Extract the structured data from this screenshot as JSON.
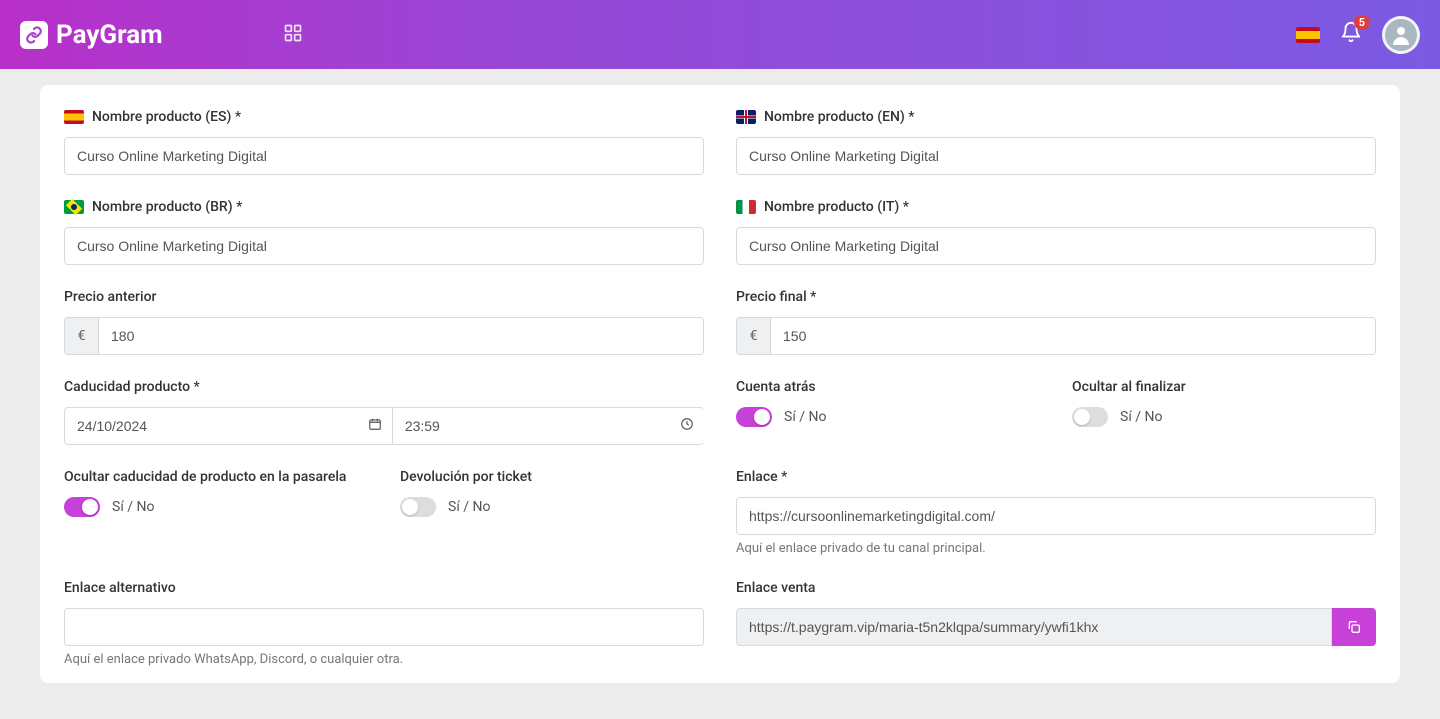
{
  "brand": {
    "name": "PayGram"
  },
  "topbar": {
    "notifications": "5"
  },
  "form": {
    "name_es_label": "Nombre producto (ES) *",
    "name_es_value": "Curso Online Marketing Digital",
    "name_en_label": "Nombre producto (EN) *",
    "name_en_value": "Curso Online Marketing Digital",
    "name_br_label": "Nombre producto (BR) *",
    "name_br_value": "Curso Online Marketing Digital",
    "name_it_label": "Nombre producto (IT) *",
    "name_it_value": "Curso Online Marketing Digital",
    "old_price_label": "Precio anterior",
    "old_price_value": "180",
    "final_price_label": "Precio final *",
    "final_price_value": "150",
    "currency_symbol": "€",
    "expiry_label": "Caducidad producto *",
    "expiry_date": "24/10/2024",
    "expiry_time": "23:59",
    "countdown_label": "Cuenta atrás",
    "hide_on_end_label": "Ocultar al finalizar",
    "hide_expiry_label": "Ocultar caducidad de producto en la pasarela",
    "refund_ticket_label": "Devolución por ticket",
    "toggle_text": "Sí / No",
    "link_label": "Enlace *",
    "link_value": "https://cursoonlinemarketingdigital.com/",
    "link_help": "Aquí el enlace privado de tu canal principal.",
    "alt_link_label": "Enlace alternativo",
    "alt_link_value": "",
    "alt_link_help": "Aquí el enlace privado WhatsApp, Discord, o cualquier otra.",
    "sale_link_label": "Enlace venta",
    "sale_link_value": "https://t.paygram.vip/maria-t5n2klqpa/summary/ywfi1khx"
  },
  "toggles": {
    "countdown_on": true,
    "hide_on_end_on": false,
    "hide_expiry_on": true,
    "refund_ticket_on": false
  }
}
